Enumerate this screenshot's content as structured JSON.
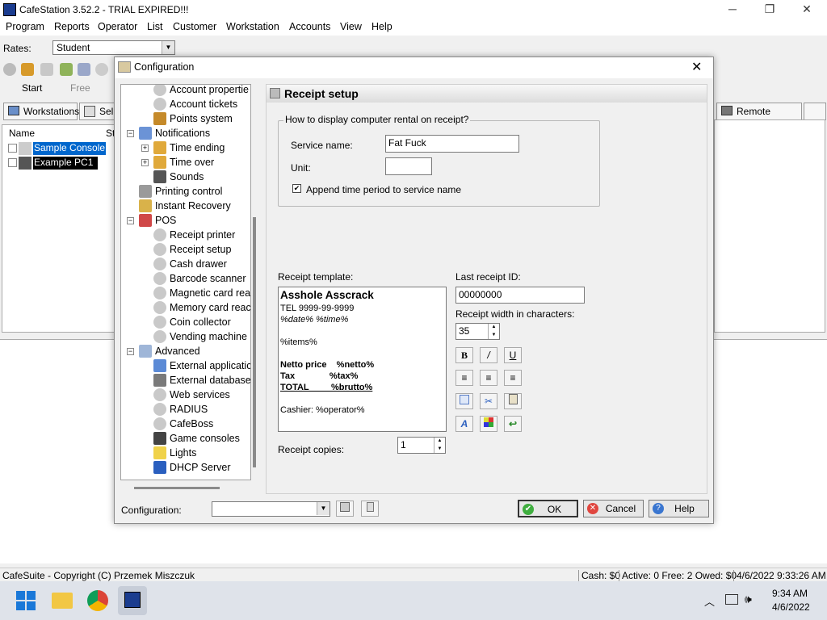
{
  "app": {
    "title": "CafeStation 3.52.2 - TRIAL EXPIRED!!!",
    "menu": [
      "Program",
      "Reports",
      "Operator",
      "List",
      "Customer",
      "Workstation",
      "Accounts",
      "View",
      "Help"
    ],
    "rates_label": "Rates:",
    "rates_value": "Student",
    "toolbar_start": "Start",
    "toolbar_free": "Free",
    "tabs": {
      "workstations": "Workstations",
      "sell": "Sell",
      "remote": "Remote control"
    },
    "columns": {
      "name": "Name",
      "status": "St"
    },
    "workstations": [
      "Sample Console",
      "Example PC1"
    ],
    "status": {
      "copyright": "CafeSuite - Copyright (C) Przemek Miszczuk",
      "cash": "Cash: $0",
      "active": "Active: 0 Free: 2 Owed: $0",
      "datetime": "4/6/2022 9:33:26 AM"
    },
    "taskbar": {
      "time": "9:34 AM",
      "date": "4/6/2022"
    }
  },
  "dialog": {
    "title": "Configuration",
    "tree": [
      {
        "label": "Account propertie",
        "icon": "gear-icon"
      },
      {
        "label": "Account tickets",
        "icon": "gear-icon"
      },
      {
        "label": "Points system",
        "icon": "points-icon"
      },
      {
        "label": "Notifications",
        "icon": "chat-bubble-icon"
      },
      {
        "label": "Time ending",
        "icon": "clock-icon"
      },
      {
        "label": "Time over",
        "icon": "clock-icon"
      },
      {
        "label": "Sounds",
        "icon": "music-note-icon"
      },
      {
        "label": "Printing control",
        "icon": "printer-icon"
      },
      {
        "label": "Instant Recovery",
        "icon": "wrench-icon"
      },
      {
        "label": "POS",
        "icon": "pos-icon"
      },
      {
        "label": "Receipt printer",
        "icon": "gear-icon"
      },
      {
        "label": "Receipt setup",
        "icon": "gear-icon"
      },
      {
        "label": "Cash drawer",
        "icon": "gear-icon"
      },
      {
        "label": "Barcode scanner",
        "icon": "gear-icon"
      },
      {
        "label": "Magnetic card rea",
        "icon": "gear-icon"
      },
      {
        "label": "Memory card reac",
        "icon": "gear-icon"
      },
      {
        "label": "Coin collector",
        "icon": "gear-icon"
      },
      {
        "label": "Vending machine",
        "icon": "gear-icon"
      },
      {
        "label": "Advanced",
        "icon": "advanced-icon"
      },
      {
        "label": "External applicatic",
        "icon": "window-icon"
      },
      {
        "label": "External database",
        "icon": "database-icon"
      },
      {
        "label": "Web services",
        "icon": "gear-icon"
      },
      {
        "label": "RADIUS",
        "icon": "gear-icon"
      },
      {
        "label": "CafeBoss",
        "icon": "gear-icon"
      },
      {
        "label": "Game consoles",
        "icon": "joystick-icon"
      },
      {
        "label": "Lights",
        "icon": "bulb-icon"
      },
      {
        "label": "DHCP Server",
        "icon": "network-icon"
      }
    ],
    "panel": {
      "heading": "Receipt setup",
      "group_title": "How to display computer rental on receipt?",
      "service_name_label": "Service name:",
      "service_name_value": "Fat Fuck",
      "unit_label": "Unit:",
      "unit_value": "",
      "append_label": "Append time period to service name",
      "append_checked": true,
      "template_label": "Receipt template:",
      "template_lines": [
        "Asshole Asscrack",
        "TEL 9999-99-9999",
        "%date% %time%",
        "",
        "%items%",
        "",
        "Netto price    %netto%",
        "Tax              %tax%",
        "TOTAL         %brutto%",
        "",
        "Cashier: %operator%"
      ],
      "last_id_label": "Last receipt ID:",
      "last_id_value": "00000000",
      "width_label": "Receipt width in characters:",
      "width_value": "35",
      "copies_label": "Receipt copies:",
      "copies_value": "1"
    },
    "footer": {
      "config_label": "Configuration:",
      "ok": "OK",
      "cancel": "Cancel",
      "help": "Help"
    }
  }
}
